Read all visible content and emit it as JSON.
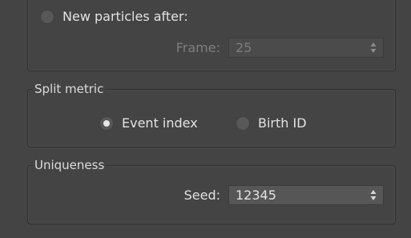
{
  "spawn_group": {
    "option_label": "New particles after:",
    "frame_label": "Frame:",
    "frame_value": "25"
  },
  "split_metric": {
    "title": "Split metric",
    "options": [
      {
        "label": "Event index",
        "selected": true
      },
      {
        "label": "Birth ID",
        "selected": false
      }
    ]
  },
  "uniqueness": {
    "title": "Uniqueness",
    "seed_label": "Seed:",
    "seed_value": "12345"
  },
  "colors": {
    "background": "#444444",
    "text": "#dcdcdc",
    "disabled_text": "#7e7e7e",
    "border": "#2e2e2e"
  },
  "icons": [
    "radio-button-icon",
    "spinner-arrows-icon"
  ]
}
